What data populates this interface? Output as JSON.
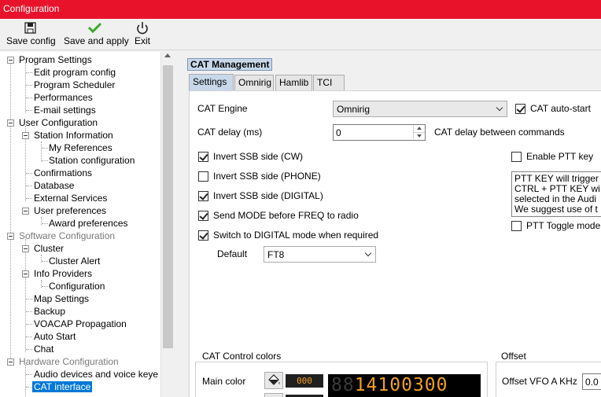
{
  "window": {
    "title": "Configuration"
  },
  "toolbar": {
    "save_config": "Save config",
    "save_apply": "Save and apply",
    "exit": "Exit"
  },
  "tree": {
    "items": [
      "Program Settings",
      "Edit program config",
      "Program Scheduler",
      "Performances",
      "E-mail settings",
      "User Configuration",
      "Station Information",
      "My References",
      "Station configuration",
      "Confirmations",
      "Database",
      "External Services",
      "User preferences",
      "Award preferences",
      "Software Configuration",
      "Cluster",
      "Cluster Alert",
      "Info Providers",
      "Configuration",
      "Map Settings",
      "Backup",
      "VOACAP Propagation",
      "Auto Start",
      "Chat",
      "Hardware Configuration",
      "Audio devices and voice keye",
      "CAT interface"
    ]
  },
  "panel": {
    "header": "CAT Management",
    "tabs": [
      "Settings",
      "Omnirig",
      "Hamlib",
      "TCI"
    ],
    "cat_engine_label": "CAT Engine",
    "cat_engine_value": "Omnirig",
    "cat_autostart_label": "CAT auto-start",
    "cat_autostart_checked": true,
    "cat_delay_label": "CAT delay (ms)",
    "cat_delay_value": "0",
    "cat_delay_desc": "CAT delay between commands",
    "options": [
      {
        "label": "Invert SSB side (CW)",
        "checked": true
      },
      {
        "label": "Invert SSB side (PHONE)",
        "checked": false
      },
      {
        "label": "Invert SSB side (DIGITAL)",
        "checked": true
      },
      {
        "label": "Send MODE before FREQ to radio",
        "checked": true
      },
      {
        "label": "Switch to DIGITAL mode when required",
        "checked": true
      }
    ],
    "default_label": "Default",
    "default_value": "FT8",
    "enable_ptt_label": "Enable PTT key",
    "ptt_text": [
      "PTT KEY will trigger",
      "CTRL + PTT KEY wi",
      "selected in the Audi",
      "We suggest use of t"
    ],
    "ptt_toggle_label": "PTT Toggle mode",
    "colors_group": "CAT Control colors",
    "main_color_label": "Main color",
    "main_color_code": "000",
    "freq_dim": "88",
    "freq_lit": "14100300",
    "offset_group": "Offset",
    "offset_label": "Offset VFO A KHz",
    "offset_value": "0.0"
  }
}
